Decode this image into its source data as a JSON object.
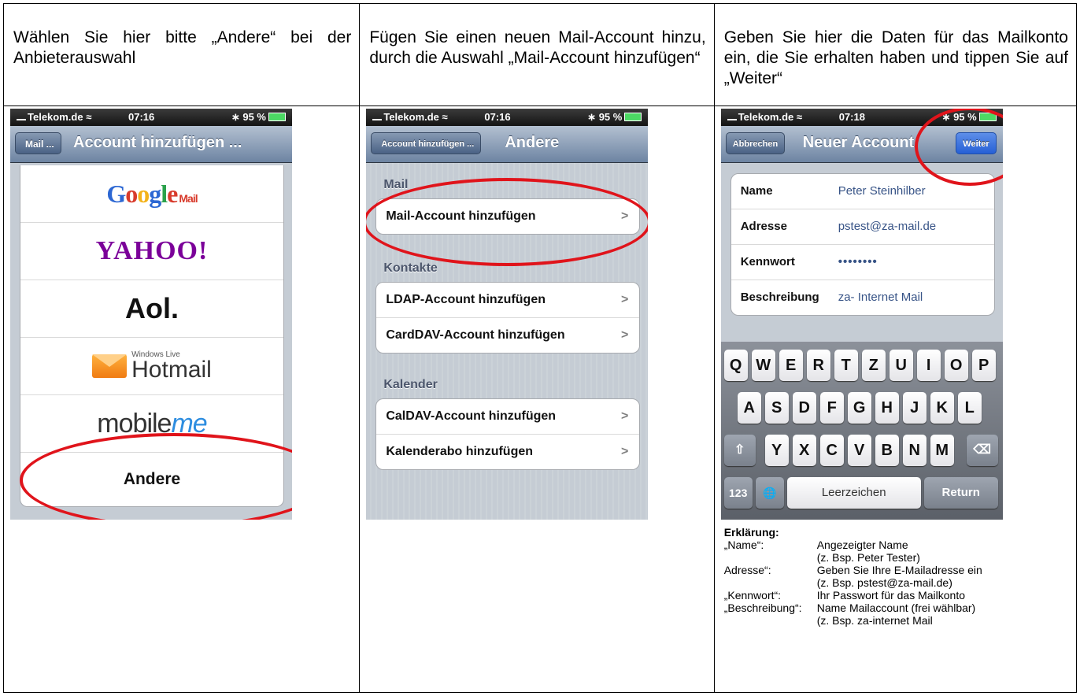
{
  "columns": [
    {
      "instruction": "Wählen Sie hier bitte „Andere“ bei der Anbieterauswahl"
    },
    {
      "instruction": "Fügen Sie einen neuen Mail-Account hinzu, durch die Auswahl „Mail-Account hinzufügen“"
    },
    {
      "instruction": "Geben Sie hier die Daten für das Mailkonto ein, die Sie erhalten haben und tippen Sie auf „Weiter“"
    }
  ],
  "statusbar": {
    "carrier": "Telekom.de",
    "battery": "95 %"
  },
  "phone1": {
    "time": "07:16",
    "back_label": "Mail ...",
    "title": "Account hinzufügen ...",
    "providers": {
      "google": "Google",
      "google_sub": "Mail",
      "yahoo": "YAHOO!",
      "aol": "Aol.",
      "hotmail_small": "Windows Live",
      "hotmail": "Hotmail",
      "mobileme_a": "mobile",
      "mobileme_b": "me",
      "andere": "Andere"
    }
  },
  "phone2": {
    "time": "07:16",
    "back_label": "Account hinzufügen ...",
    "title": "Andere",
    "groups": {
      "mail": {
        "label": "Mail",
        "rows": [
          "Mail-Account hinzufügen"
        ]
      },
      "kontakte": {
        "label": "Kontakte",
        "rows": [
          "LDAP-Account hinzufügen",
          "CardDAV-Account hinzufügen"
        ]
      },
      "kalender": {
        "label": "Kalender",
        "rows": [
          "CalDAV-Account hinzufügen",
          "Kalenderabo hinzufügen"
        ]
      }
    },
    "chevron": ">"
  },
  "phone3": {
    "time": "07:18",
    "cancel_label": "Abbrechen",
    "title": "Neuer Account",
    "next_label": "Weiter",
    "fields": [
      {
        "label": "Name",
        "value": "Peter Steinhilber"
      },
      {
        "label": "Adresse",
        "value": "pstest@za-mail.de"
      },
      {
        "label": "Kennwort",
        "value": "••••••••"
      },
      {
        "label": "Beschreibung",
        "value": "za- Internet Mail"
      }
    ],
    "keyboard": {
      "row1": [
        "Q",
        "W",
        "E",
        "R",
        "T",
        "Z",
        "U",
        "I",
        "O",
        "P"
      ],
      "row2": [
        "A",
        "S",
        "D",
        "F",
        "G",
        "H",
        "J",
        "K",
        "L"
      ],
      "row3": [
        "Y",
        "X",
        "C",
        "V",
        "B",
        "N",
        "M"
      ],
      "shift": "⇧",
      "backspace": "⌫",
      "numbers": "123",
      "globe": "🌐",
      "space": "Leerzeichen",
      "return": "Return"
    }
  },
  "explanation": {
    "title": "Erklärung:",
    "rows": [
      {
        "k": "„Name“:",
        "v": "Angezeigter Name"
      },
      {
        "k": "",
        "v": "(z. Bsp. Peter Tester)"
      },
      {
        "k": "Adresse“:",
        "v": "Geben Sie Ihre E-Mailadresse ein"
      },
      {
        "k": "",
        "v": "(z. Bsp. pstest@za-mail.de)"
      },
      {
        "k": "„Kennwort“:",
        "v": "Ihr Passwort für das Mailkonto"
      },
      {
        "k": "„Beschreibung“:",
        "v": "Name Mailaccount (frei wählbar)"
      },
      {
        "k": "",
        "v": "(z. Bsp. za-internet Mail"
      }
    ]
  },
  "colors": {
    "highlight": "#e0141b",
    "navbar": "#6d84a2",
    "value_text": "#385487"
  }
}
